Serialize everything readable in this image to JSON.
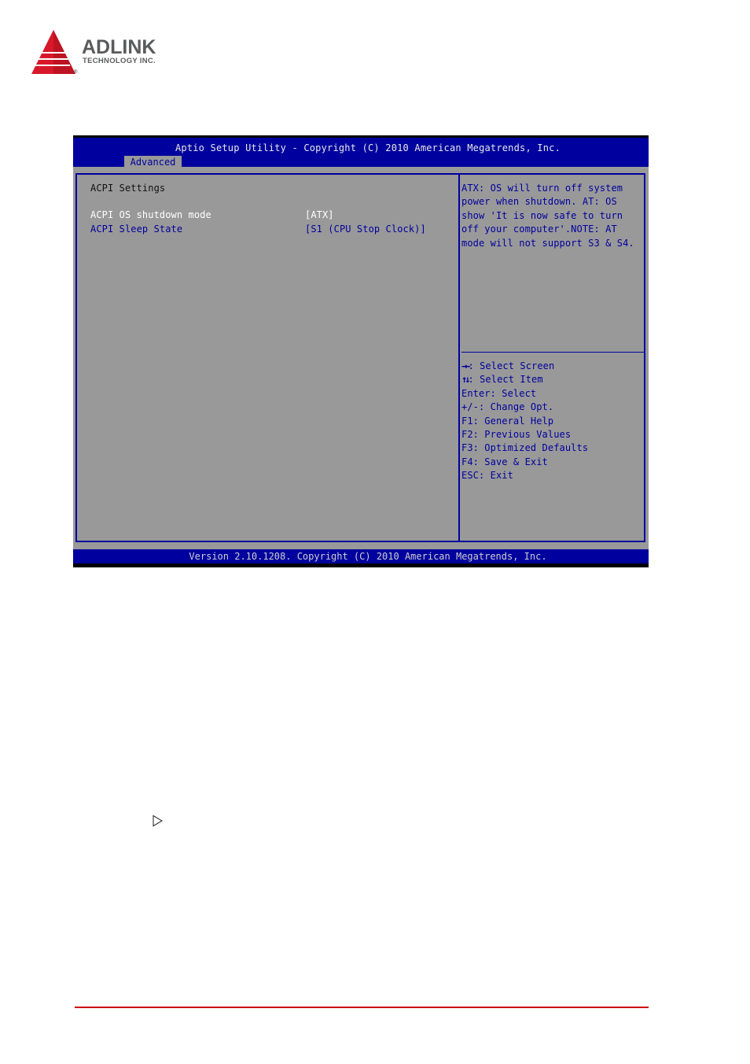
{
  "logo": {
    "name": "ADLINK",
    "subtitle": "TECHNOLOGY INC.",
    "registered": "®",
    "accent_color": "#d7182a"
  },
  "bios": {
    "title": "Aptio Setup Utility - Copyright (C) 2010 American Megatrends, Inc.",
    "active_tab": "Advanced",
    "section_title": "ACPI Settings",
    "items": [
      {
        "label": "ACPI OS shutdown mode",
        "value": "[ATX]",
        "selected": true
      },
      {
        "label": "ACPI Sleep State",
        "value": "[S1 (CPU Stop Clock)]",
        "selected": false
      }
    ],
    "help_text": "ATX: OS will turn off system\npower when shutdown. AT: OS\nshow 'It is now safe to turn\noff your computer'.NOTE: AT\nmode will not support S3 & S4.",
    "key_legend": [
      {
        "keys": "→←",
        "action": ": Select Screen"
      },
      {
        "keys": "↑↓",
        "action": ": Select Item"
      },
      {
        "keys": "Enter",
        "action": ": Select"
      },
      {
        "keys": "+/-",
        "action": ": Change Opt."
      },
      {
        "keys": "F1",
        "action": ": General Help"
      },
      {
        "keys": "F2",
        "action": ": Previous Values"
      },
      {
        "keys": "F3",
        "action": ": Optimized Defaults"
      },
      {
        "keys": "F4",
        "action": ": Save & Exit"
      },
      {
        "keys": "ESC",
        "action": ": Exit"
      }
    ],
    "footer": "Version 2.10.1208. Copyright (C) 2010 American Megatrends, Inc.",
    "colors": {
      "blue": "#00009e",
      "gray": "#999999",
      "highlight": "#ffffff"
    }
  },
  "page": {
    "bullet_icon": "triangle-right-outline-icon",
    "rule_color": "#cc0011"
  }
}
